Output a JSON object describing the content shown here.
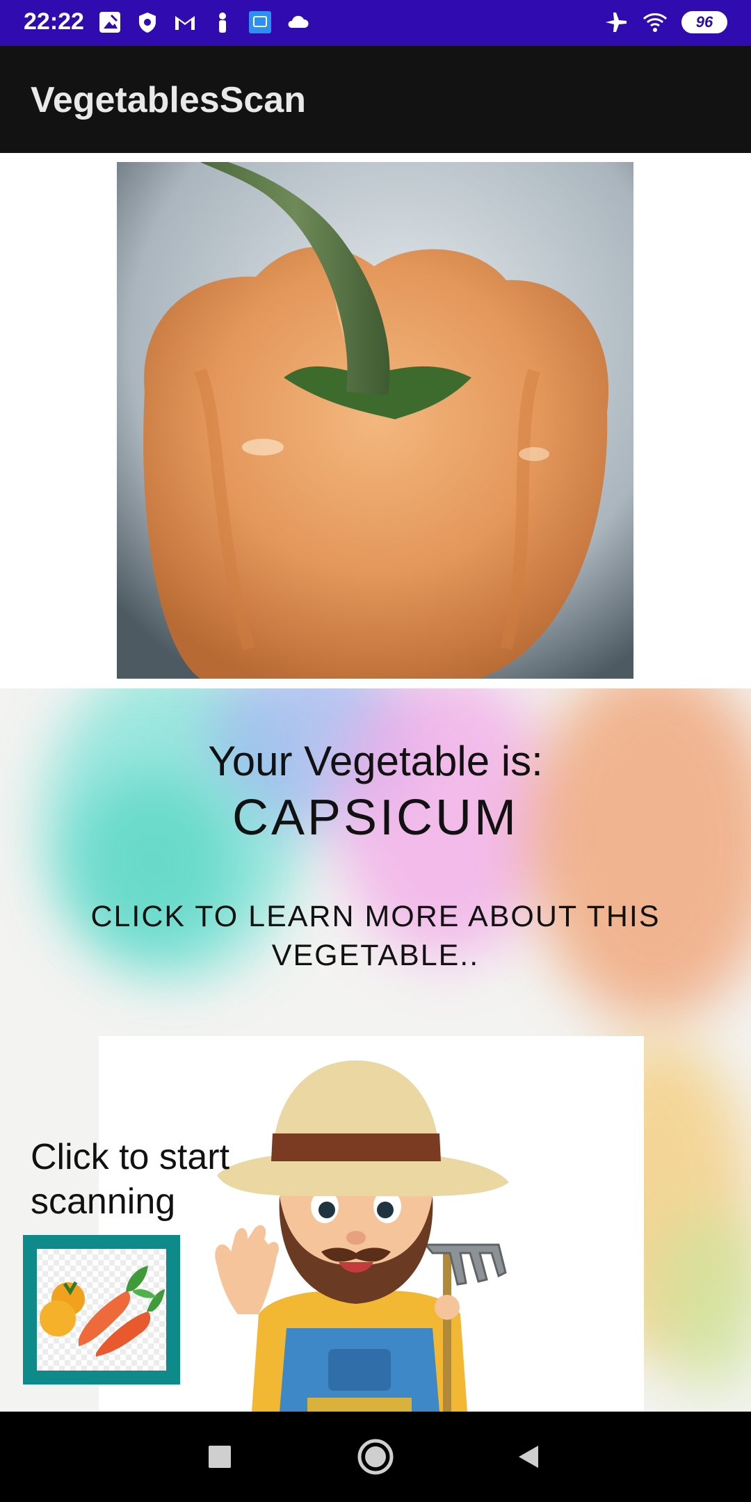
{
  "status_bar": {
    "time": "22:22",
    "battery": "96",
    "left_icons": [
      "image-icon",
      "shield-icon",
      "gmail-icon",
      "person-icon",
      "app-icon",
      "cloud-icon"
    ],
    "right_icons": [
      "airplane-icon",
      "wifi-icon",
      "battery-icon"
    ]
  },
  "app_bar": {
    "title": "VegetablesScan"
  },
  "result": {
    "label": "Your Vegetable is:",
    "value": "CAPSICUM"
  },
  "learn_more": {
    "label": "CLICK TO LEARN MORE ABOUT THIS VEGETABLE.."
  },
  "scan": {
    "label": "Click to start scanning"
  },
  "colors": {
    "status_bar": "#2f0bb0",
    "app_bar": "#121212",
    "scan_button_border": "#0f8a8a",
    "nav_bar": "#000000"
  }
}
